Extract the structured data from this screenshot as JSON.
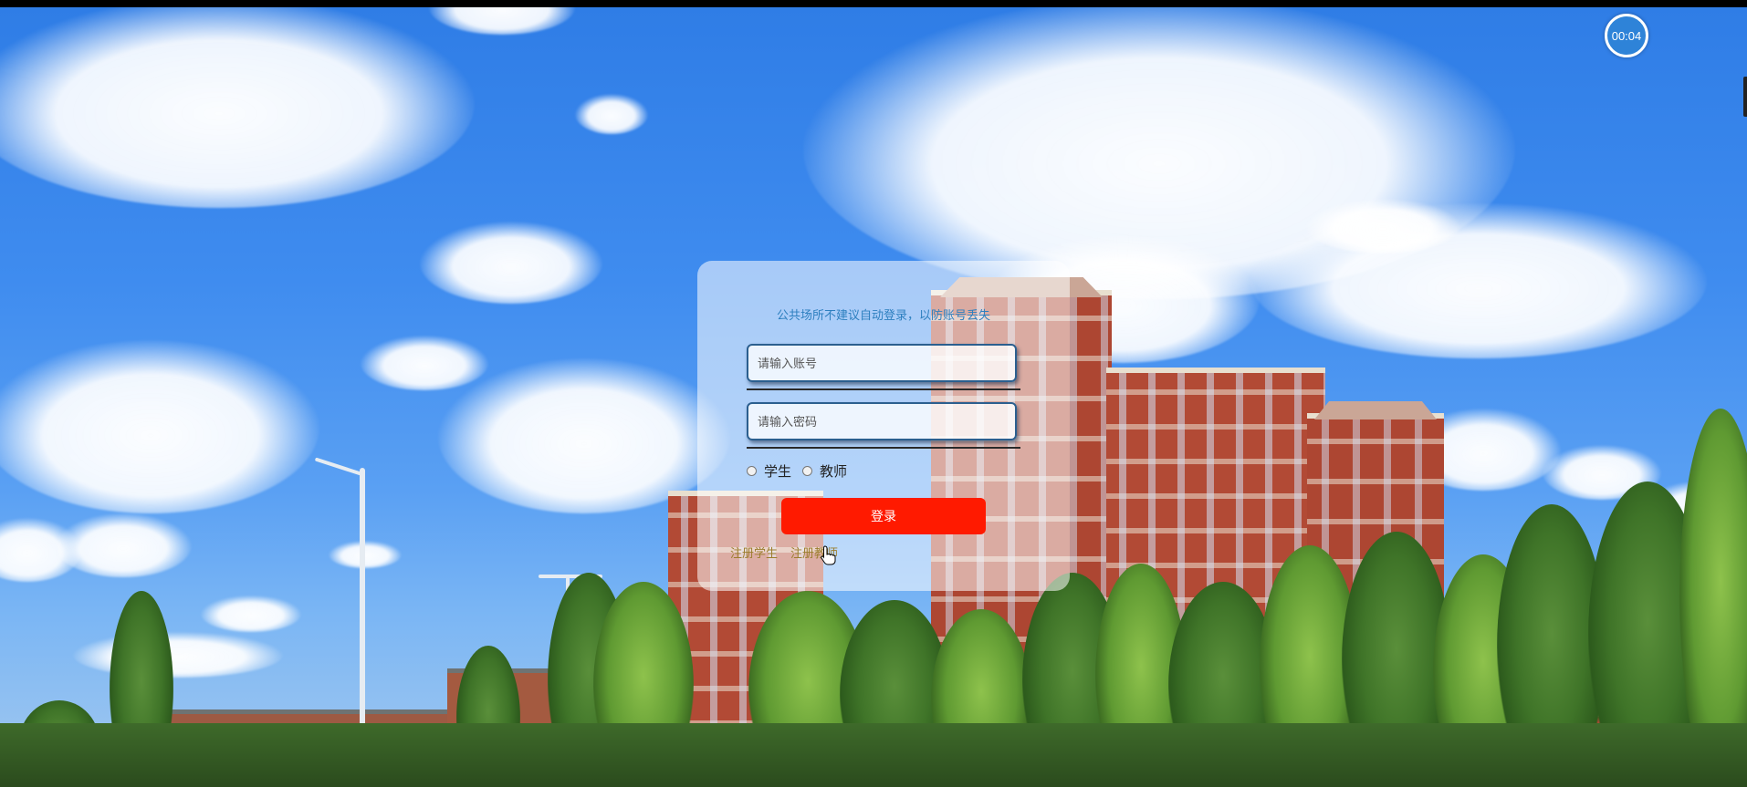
{
  "timer": {
    "value": "00:04"
  },
  "login": {
    "notice": "公共场所不建议自动登录，以防账号丢失",
    "account_placeholder": "请输入账号",
    "password_placeholder": "请输入密码",
    "roles": [
      {
        "label": "学生"
      },
      {
        "label": "教师"
      }
    ],
    "submit_label": "登录",
    "links": [
      {
        "label": "注册学生"
      },
      {
        "label": "注册教师"
      }
    ]
  },
  "colors": {
    "submit_button": "#ff1a00",
    "notice_text": "#2d7fbf",
    "link_text": "#9b7d2c",
    "timer_badge": "#2e83d8"
  },
  "icons": [
    "pointer-cursor-icon"
  ]
}
